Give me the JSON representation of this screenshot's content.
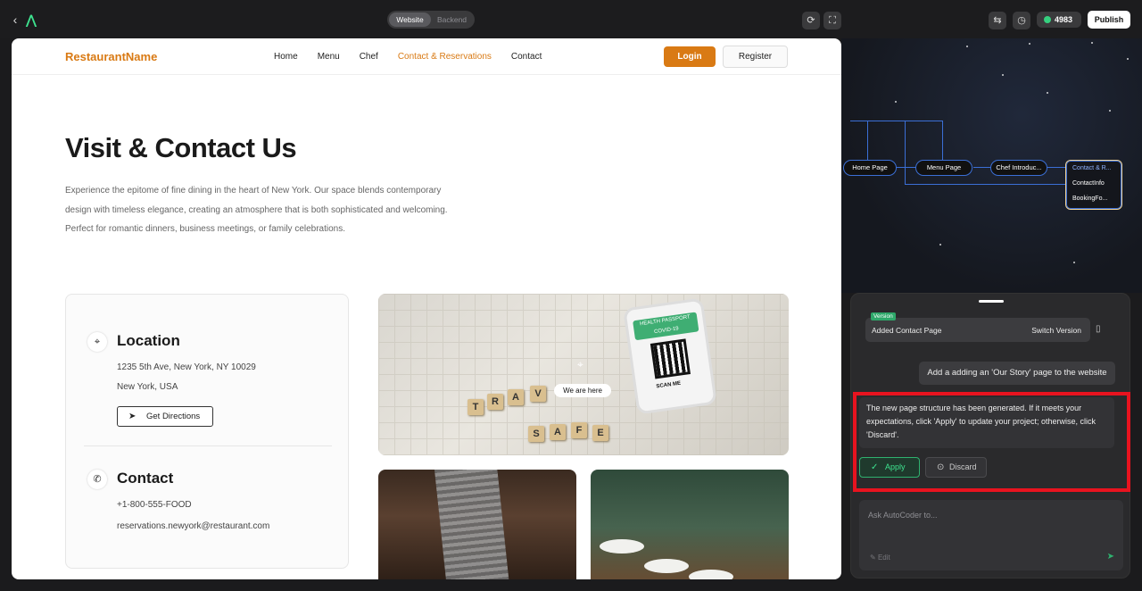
{
  "topbar": {
    "back_icon": "chevron-left-icon",
    "logo_icon": "app-logo-icon",
    "mode_tabs": [
      "Website",
      "Backend"
    ],
    "active_mode": "Website",
    "refresh_icon": "refresh-icon",
    "fullscreen_icon": "fullscreen-icon",
    "code_icon": "code-toggle-icon",
    "history_icon": "history-icon",
    "credits": "4983",
    "publish_label": "Publish"
  },
  "site": {
    "logo": "RestaurantName",
    "nav": [
      "Home",
      "Menu",
      "Chef",
      "Contact & Reservations",
      "Contact"
    ],
    "active_nav": "Contact & Reservations",
    "login_label": "Login",
    "register_label": "Register",
    "heading": "Visit & Contact Us",
    "intro": "Experience the epitome of fine dining in the heart of New York. Our space blends contemporary design with timeless elegance, creating an atmosphere that is both sophisticated and welcoming. Perfect for romantic dinners, business meetings, or family celebrations.",
    "location": {
      "title": "Location",
      "line1": "1235 5th Ave, New York, NY 10029",
      "line2": "New York, USA",
      "directions_label": "Get Directions"
    },
    "contact": {
      "title": "Contact",
      "phone": "+1-800-555-FOOD",
      "email": "reservations.newyork@restaurant.com"
    },
    "map_chip": "We are here",
    "phone_text": "HEALTH PASSPORT COVID-19",
    "phone_scan": "SCAN ME",
    "tiles_travel": [
      "T",
      "R",
      "A",
      "V"
    ],
    "tiles_safe": [
      "S",
      "A",
      "F",
      "E"
    ]
  },
  "graph": {
    "nodes": [
      "Home Page",
      "Menu Page",
      "Chef Introduc..."
    ],
    "group": [
      "Contact & R...",
      "ContactInfo",
      "BookingFo..."
    ]
  },
  "chat": {
    "version_tag": "Version",
    "version_name": "Added Contact Page",
    "switch_label": "Switch Version",
    "user_message": "Add a adding an 'Our Story' page to the website",
    "assistant_message": "The new page structure has been generated. If it meets your expectations, click 'Apply' to update your project; otherwise, click 'Discard'.",
    "apply_label": "Apply",
    "discard_label": "Discard",
    "input_placeholder": "Ask AutoCoder to...",
    "edit_label": "Edit"
  },
  "colors": {
    "brand": "#d97a14",
    "accent_green": "#2fb26f",
    "highlight_red": "#e8131f",
    "graph_line": "#3b6fd6"
  }
}
